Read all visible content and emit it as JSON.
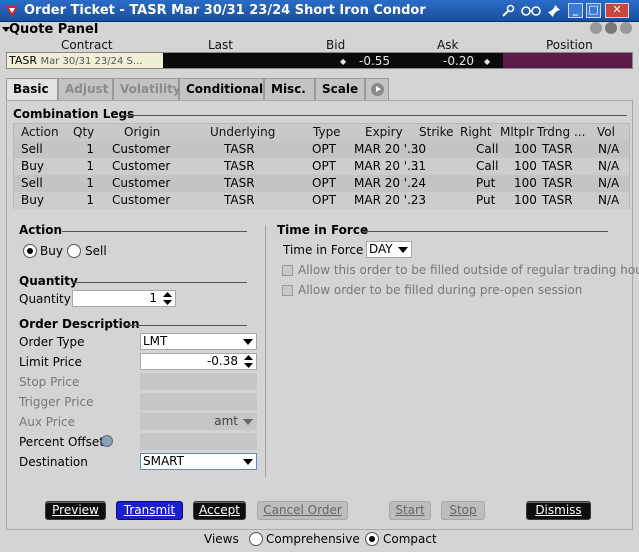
{
  "window": {
    "title": "Order Ticket - TASR Mar 30/31 23/24 Short Iron Condor",
    "accent": "#1a4f9e"
  },
  "quote_panel": {
    "title": "Quote Panel",
    "headers": {
      "contract": "Contract",
      "last": "Last",
      "bid": "Bid",
      "ask": "Ask",
      "position": "Position"
    },
    "contract_symbol": "TASR",
    "contract_desc": "Mar 30/31 23/24 S...",
    "last": "",
    "bid": "-0.55",
    "ask": "-0.20",
    "position": ""
  },
  "tabs": [
    {
      "label": "Basic",
      "state": "active"
    },
    {
      "label": "Adjust",
      "state": "disabled"
    },
    {
      "label": "Volatility",
      "state": "disabled"
    },
    {
      "label": "Conditional",
      "state": "normal"
    },
    {
      "label": "Misc.",
      "state": "normal"
    },
    {
      "label": "Scale",
      "state": "normal"
    }
  ],
  "legs": {
    "title": "Combination Legs",
    "columns": [
      "Action",
      "Qty",
      "Origin",
      "Underlying",
      "Type",
      "Expiry",
      "Strike",
      "Right",
      "Mltplr",
      "Trdng ...",
      "Vol"
    ],
    "rows": [
      [
        "Sell",
        "1",
        "Customer",
        "TASR",
        "OPT",
        "MAR 20 '...",
        "30",
        "Call",
        "100",
        "TASR",
        "N/A"
      ],
      [
        "Buy",
        "1",
        "Customer",
        "TASR",
        "OPT",
        "MAR 20 '...",
        "31",
        "Call",
        "100",
        "TASR",
        "N/A"
      ],
      [
        "Sell",
        "1",
        "Customer",
        "TASR",
        "OPT",
        "MAR 20 '...",
        "24",
        "Put",
        "100",
        "TASR",
        "N/A"
      ],
      [
        "Buy",
        "1",
        "Customer",
        "TASR",
        "OPT",
        "MAR 20 '...",
        "23",
        "Put",
        "100",
        "TASR",
        "N/A"
      ]
    ]
  },
  "action": {
    "title": "Action",
    "buy_label": "Buy",
    "sell_label": "Sell",
    "selected": "Buy"
  },
  "quantity": {
    "title": "Quantity",
    "label": "Quantity",
    "value": "1"
  },
  "order_description": {
    "title": "Order Description",
    "order_type_label": "Order Type",
    "order_type_value": "LMT",
    "limit_price_label": "Limit Price",
    "limit_price_value": "-0.38",
    "stop_price_label": "Stop Price",
    "trigger_price_label": "Trigger Price",
    "aux_price_label": "Aux Price",
    "aux_price_value": "amt",
    "percent_offset_label": "Percent Offset",
    "destination_label": "Destination",
    "destination_value": "SMART"
  },
  "time_in_force": {
    "title": "Time in Force",
    "label": "Time in Force",
    "value": "DAY",
    "outside_rth_label": "Allow this order to be filled outside of regular trading hours",
    "preopen_label": "Allow order to be filled during pre-open session"
  },
  "buttons": {
    "preview": "Preview",
    "transmit": "Transmit",
    "accept": "Accept",
    "cancel_order": "Cancel Order",
    "start": "Start",
    "stop": "Stop",
    "dismiss": "Dismiss"
  },
  "views": {
    "label": "Views",
    "comprehensive": "Comprehensive",
    "compact": "Compact",
    "selected": "Compact"
  }
}
